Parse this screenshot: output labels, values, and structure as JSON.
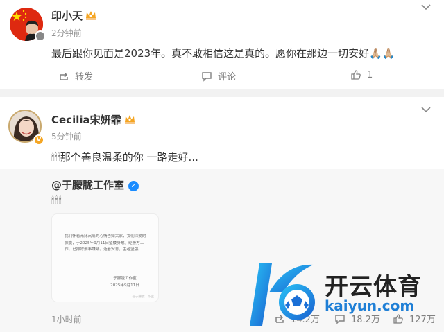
{
  "post1": {
    "name": "印小天",
    "time": "2分钟前",
    "text": "最后跟你见面是2023年。真不敢相信这是真的。愿你在那边一切安好🙏🏼🙏🏼",
    "repost_label": "转发",
    "comment_label": "评论",
    "like_count": "1"
  },
  "post2": {
    "name": "Cecilia宋妍霏",
    "badge": "V",
    "time": "5分钟前",
    "text": "🕯🕯🕯那个善良温柔的你 一路走好...",
    "repost": {
      "author": "@于朦胧工作室",
      "text": "🕯🕯🕯",
      "notice_body": "我们怀着无比沉痛的心情告知大家，我们深爱的朦胧，于2025年9月11日坠楼身故。经警方工作，已排除刑事嫌疑。逝者安息，生者坚强。",
      "notice_signer": "于朦胧工作室",
      "notice_date": "2025年9月11日",
      "notice_watermark": "@于朦胧工作室",
      "time": "1小时前",
      "repost_count": "14.2万",
      "comment_count": "18.2万",
      "like_count": "127万"
    }
  },
  "watermark": {
    "cn": "开云体育",
    "en": "kaiyun.com"
  },
  "colors": {
    "accent": "#f5a623",
    "verified": "#1a8cff",
    "watermark_blue": "#1f7fd6"
  }
}
